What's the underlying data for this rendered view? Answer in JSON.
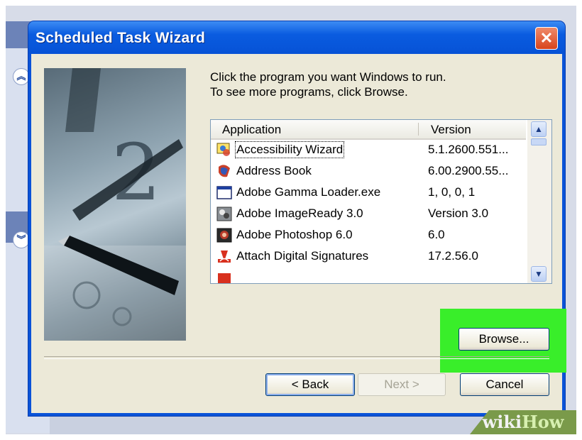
{
  "window": {
    "title": "Scheduled Task Wizard",
    "close_glyph": "✕"
  },
  "instructions": {
    "line1": "Click the program you want Windows to run.",
    "line2": "To see more programs, click Browse."
  },
  "program_list": {
    "columns": [
      "Application",
      "Version"
    ],
    "rows": [
      {
        "name": "Accessibility Wizard",
        "version": "5.1.2600.551...",
        "icon": "accessibility-wizard-icon"
      },
      {
        "name": "Address Book",
        "version": "6.00.2900.55...",
        "icon": "address-book-icon"
      },
      {
        "name": "Adobe Gamma Loader.exe",
        "version": "1, 0, 0, 1",
        "icon": "application-window-icon"
      },
      {
        "name": "Adobe ImageReady 3.0",
        "version": "Version 3.0",
        "icon": "imageready-icon"
      },
      {
        "name": "Adobe Photoshop 6.0",
        "version": "6.0",
        "icon": "photoshop-icon"
      },
      {
        "name": "Attach Digital Signatures",
        "version": "17.2.56.0",
        "icon": "digital-signature-icon"
      }
    ]
  },
  "buttons": {
    "browse": "Browse...",
    "back": "< Back",
    "next": "Next >",
    "cancel": "Cancel"
  },
  "side_panel": {
    "collapse_glyph": "︽",
    "expand_glyph": "︾"
  },
  "watermark": {
    "part1": "wiki",
    "part2": "How"
  },
  "colors": {
    "titlebar": "#0a5ce0",
    "highlight": "#39ee2a",
    "dialog_face": "#ece9d8"
  }
}
